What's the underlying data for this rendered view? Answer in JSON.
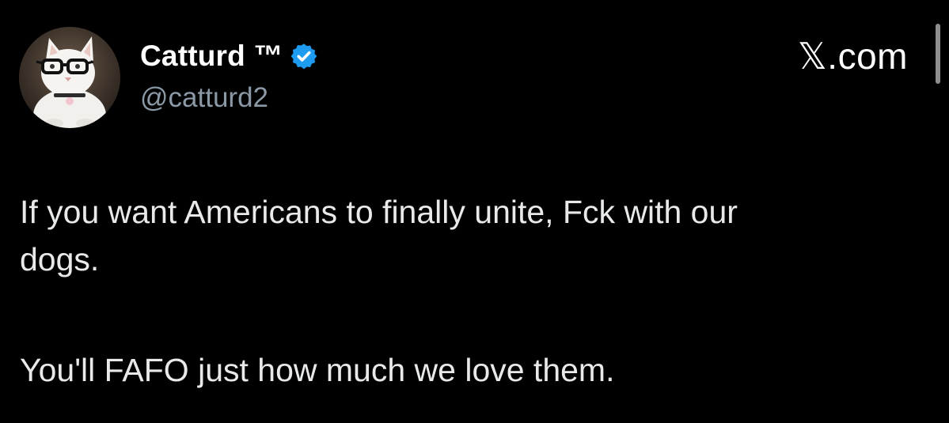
{
  "author": {
    "display_name": "Catturd ™",
    "handle": "@catturd2",
    "verified": true,
    "avatar_icon": "cat-with-glasses-avatar"
  },
  "brand": {
    "label": "𝕏.com"
  },
  "tweet": {
    "paragraph1_line1": "If you want Americans to finally unite, Fck with our",
    "paragraph1_line2": "dogs.",
    "paragraph2": "You'll FAFO just how much we love them."
  },
  "colors": {
    "background": "#000000",
    "name": "#ffffff",
    "handle": "#8b98a5",
    "text": "#e7e9ea",
    "verified_badge": "#1d9bf0"
  }
}
